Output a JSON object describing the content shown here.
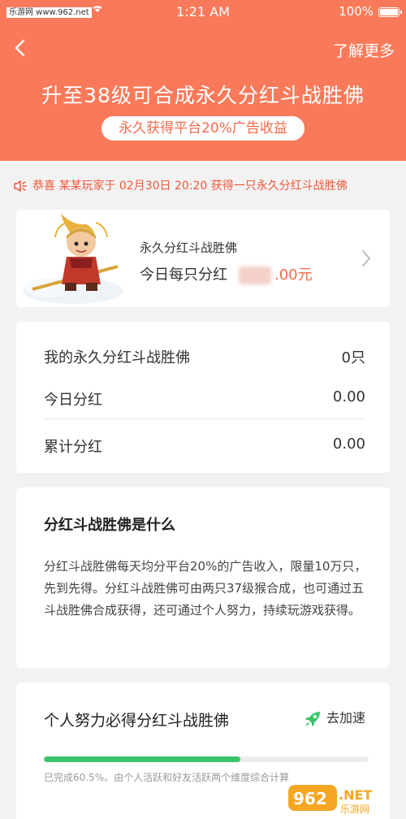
{
  "status_bar": {
    "watermark": "乐游网 www.962.net",
    "time": "1:21 AM",
    "battery": "100%"
  },
  "header": {
    "learn_more": "了解更多",
    "headline": "升至38级可合成永久分红斗战胜佛",
    "pill": "永久获得平台20%广告收益",
    "color": "#f97a5a"
  },
  "ticker": {
    "text": "恭喜 某某玩家于 02月30日 20:20 获得一只永久分红斗战胜佛",
    "color": "#f0573a"
  },
  "hero_card": {
    "title": "永久分红斗战胜佛",
    "daily_label": "今日每只分红",
    "daily_value": ".00元"
  },
  "stats": [
    {
      "label": "我的永久分红斗战胜佛",
      "value": "0只"
    },
    {
      "label": "今日分红",
      "value": "0.00"
    },
    {
      "label": "累计分红",
      "value": "0.00"
    }
  ],
  "about": {
    "title": "分红斗战胜佛是什么",
    "body": "分红斗战胜佛每天均分平台20%的广告收入，限量10万只，先到先得。分红斗战胜佛可由两只37级猴合成，也可通过五斗战胜佛合成获得，还可通过个人努力，持续玩游戏获得。"
  },
  "effort": {
    "title": "个人努力必得分红斗战胜佛",
    "speed_up": "去加速",
    "progress": 0.605,
    "progress_color": "#3bc46a",
    "note": "已完成60.5%。由个人活跃和好友活跃两个维度综合计算"
  },
  "corner_watermark": {
    "line1": "962.NET",
    "line2": "乐游网"
  }
}
